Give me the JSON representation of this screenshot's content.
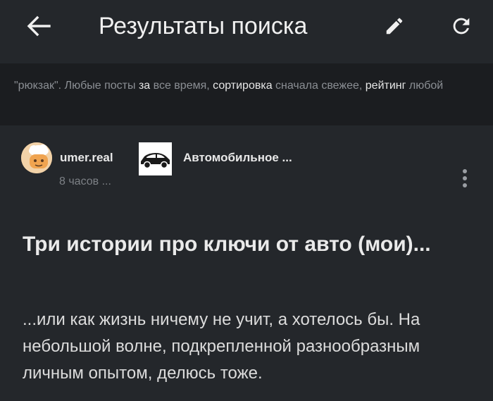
{
  "toolbar": {
    "title": "Результаты поиска",
    "back_icon": "arrow-left-icon",
    "edit_icon": "pencil-icon",
    "refresh_icon": "refresh-icon"
  },
  "filter": {
    "query": "\"рюкзак\".",
    "posts": "Любые посты",
    "period_label": "за",
    "period_value": "все время,",
    "sort_label": "сортировка",
    "sort_value": "сначала свежее,",
    "rating_label": "рейтинг",
    "rating_value": "любой"
  },
  "post": {
    "author": "umer.real",
    "community": "Автомобильное ...",
    "time": "8 часов ...",
    "title": "Три истории про ключи от авто (мои)...",
    "excerpt": "...или как жизнь ничему не учит, а хотелось бы. На небольшой волне, подкрепленной разнообразным личным опытом, делюсь тоже."
  },
  "colors": {
    "background": "#24272b",
    "filter_background": "#1b1d20",
    "text": "#e8e8e8",
    "muted": "#8b8f94"
  }
}
